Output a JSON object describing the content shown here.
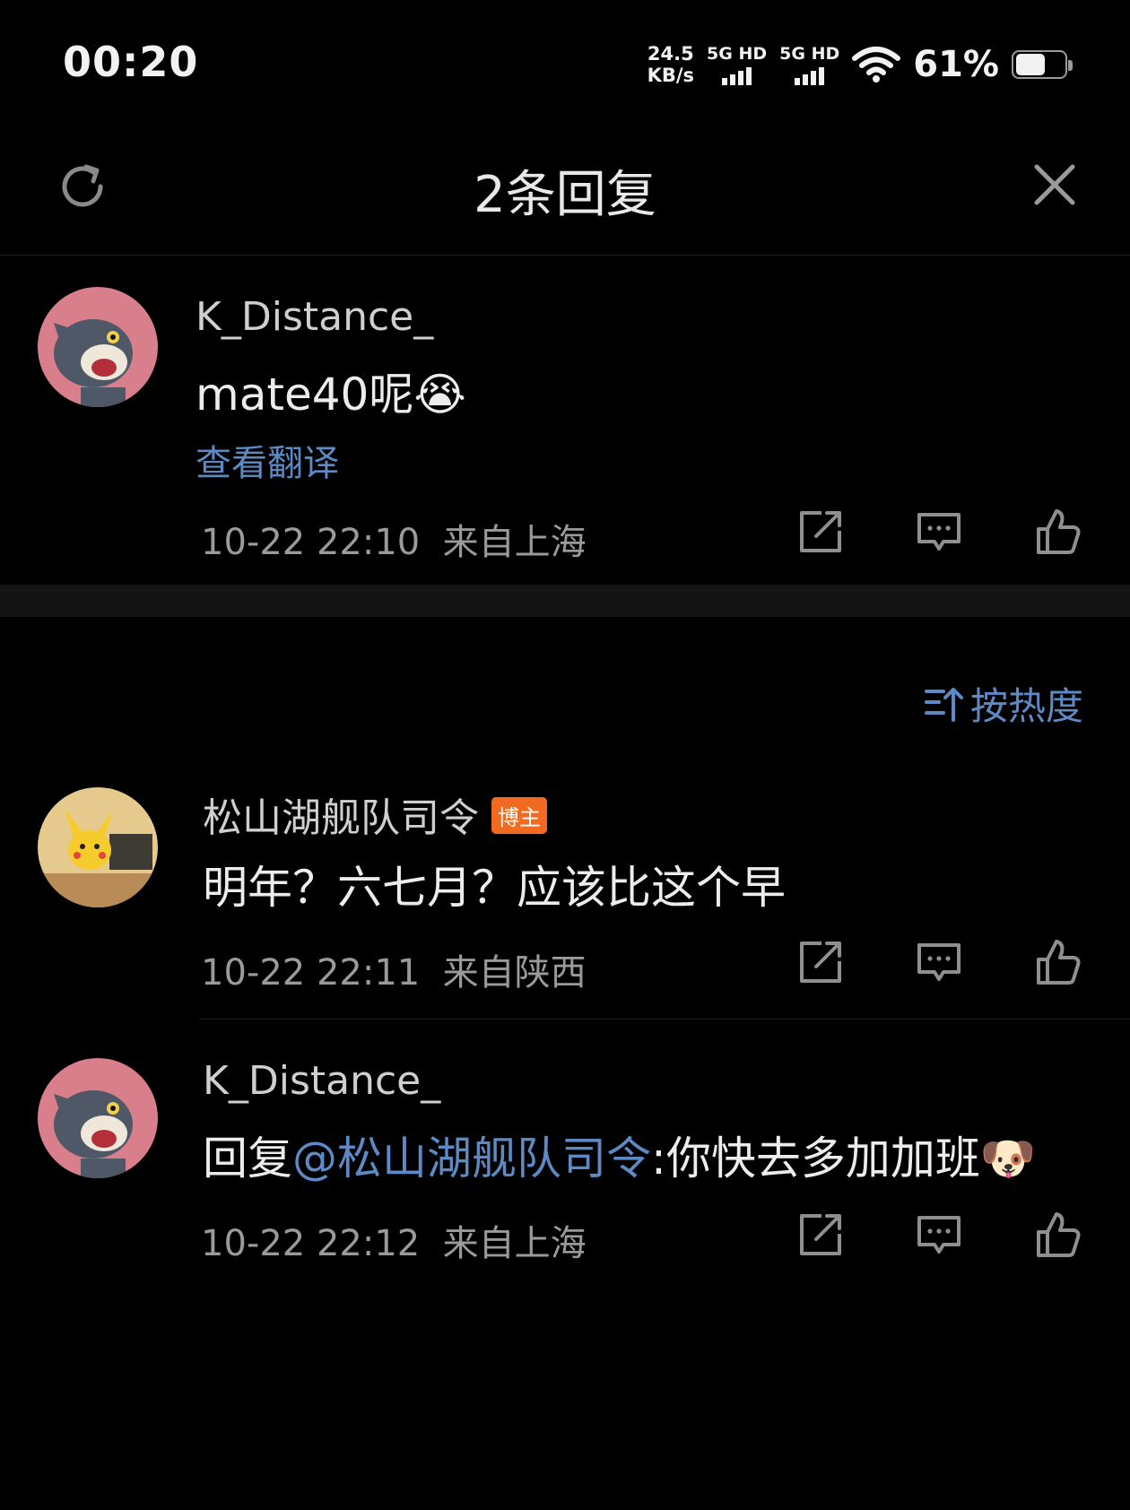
{
  "status_bar": {
    "time": "00:20",
    "speed_value": "24.5",
    "speed_unit": "KB/s",
    "sim1_label": "5G HD",
    "sim2_label": "5G HD",
    "battery_percent": "61%",
    "battery_level": 0.61
  },
  "header": {
    "title": "2条回复",
    "refresh_icon": "refresh-icon",
    "close_icon": "close-icon"
  },
  "root_comment": {
    "username": "K_Distance_",
    "text": "mate40呢",
    "emoji": "😭",
    "translate_label": "查看翻译",
    "timestamp": "10-22 22:10",
    "location": "来自上海"
  },
  "sort": {
    "label": "按热度"
  },
  "replies": [
    {
      "username": "松山湖舰队司令",
      "badge": "博主",
      "text": "明年？六七月？应该比这个早",
      "timestamp": "10-22 22:11",
      "location": "来自陕西"
    },
    {
      "username": "K_Distance_",
      "reply_prefix": "回复",
      "mention": "@松山湖舰队司令",
      "reply_text": ":你快去多加加班",
      "emoji": "🐶",
      "timestamp": "10-22 22:12",
      "location": "来自上海"
    }
  ],
  "colors": {
    "background": "#000000",
    "link": "#5d8ac4",
    "badge": "#f26a21",
    "meta": "#9a9a9a"
  }
}
